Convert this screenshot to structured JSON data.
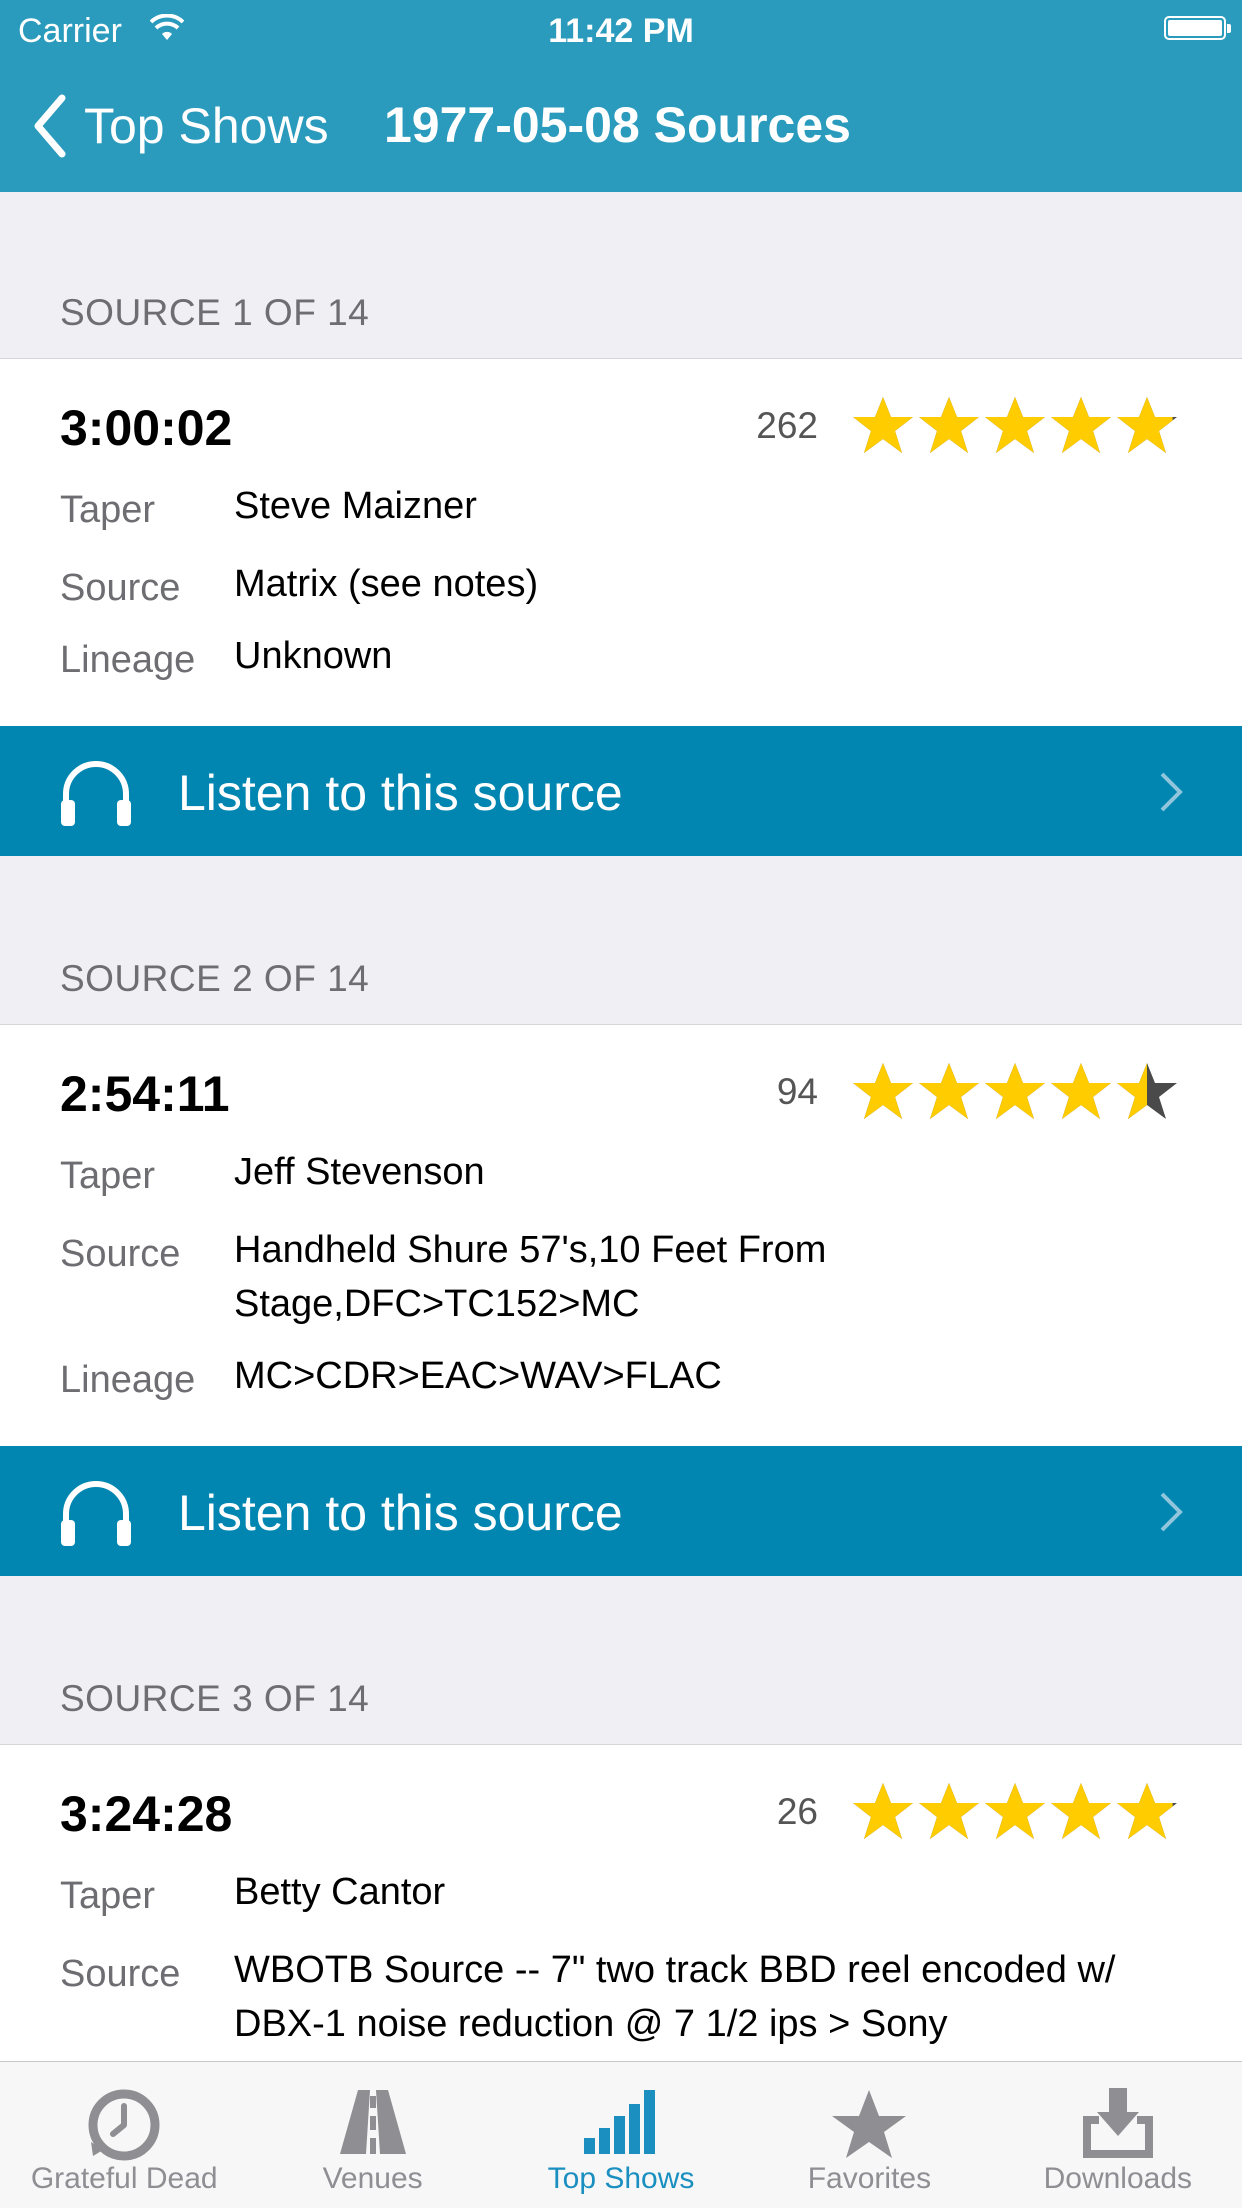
{
  "status": {
    "carrier": "Carrier",
    "time": "11:42 PM"
  },
  "nav": {
    "back_label": "Top Shows",
    "title": "1977-05-08 Sources"
  },
  "sources": [
    {
      "header": "SOURCE 1 OF 14",
      "duration": "3:00:02",
      "count": "262",
      "rating": 4.9,
      "rows": [
        {
          "label": "Taper",
          "value": "Steve Maizner"
        },
        {
          "label": "Source",
          "value": "Matrix (see notes)"
        },
        {
          "label": "Lineage",
          "value": "Unknown"
        }
      ],
      "listen_label": "Listen to this source"
    },
    {
      "header": "SOURCE 2 OF 14",
      "duration": "2:54:11",
      "count": "94",
      "rating": 4.5,
      "rows": [
        {
          "label": "Taper",
          "value": "Jeff Stevenson"
        },
        {
          "label": "Source",
          "value": "Handheld Shure 57's,10 Feet From Stage,DFC>TC152>MC"
        },
        {
          "label": "Lineage",
          "value": "MC>CDR>EAC>WAV>FLAC"
        }
      ],
      "listen_label": "Listen to this source"
    },
    {
      "header": "SOURCE 3 OF 14",
      "duration": "3:24:28",
      "count": "26",
      "rating": 4.9,
      "rows": [
        {
          "label": "Taper",
          "value": "Betty Cantor"
        },
        {
          "label": "Source",
          "value": "WBOTB Source -- 7\" two track BBD reel encoded w/ DBX-1 noise reduction @ 7 1/2 ips > Sony"
        }
      ]
    }
  ],
  "tabs": [
    {
      "label": "Grateful Dead",
      "icon": "clock-icon",
      "active": false
    },
    {
      "label": "Venues",
      "icon": "road-icon",
      "active": false
    },
    {
      "label": "Top Shows",
      "icon": "bars-icon",
      "active": true
    },
    {
      "label": "Favorites",
      "icon": "star-icon",
      "active": false
    },
    {
      "label": "Downloads",
      "icon": "download-icon",
      "active": false
    }
  ],
  "colors": {
    "nav": "#2a9bbd",
    "listen": "#0086b0",
    "star": "#ffcc00",
    "star_empty": "#4a4a4a",
    "tab_active": "#1a8fc0"
  }
}
